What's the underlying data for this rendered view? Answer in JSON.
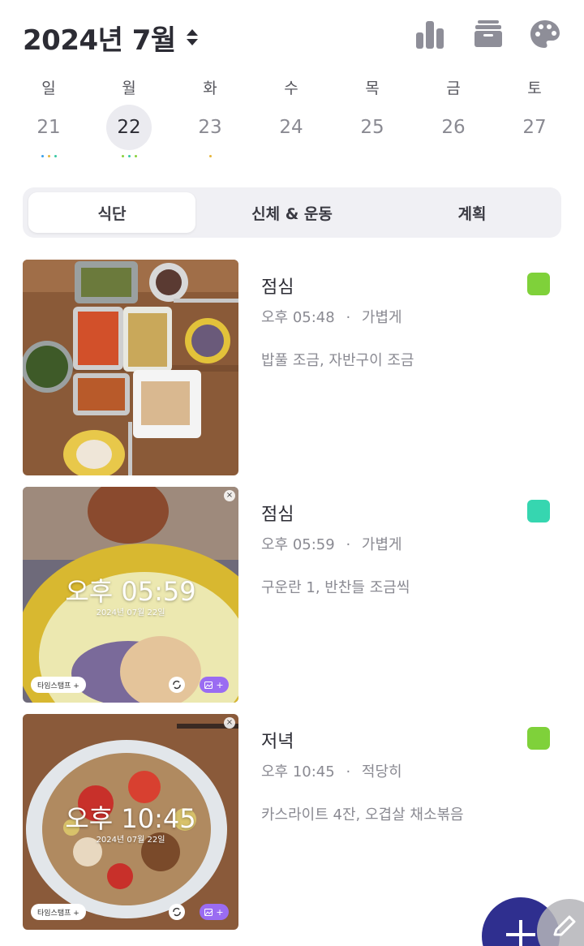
{
  "header": {
    "month_title": "2024년 7월"
  },
  "week": [
    {
      "dow": "일",
      "num": "21",
      "dots": [
        "#3aa0e8",
        "#e6b53a",
        "#38c9a4"
      ]
    },
    {
      "dow": "월",
      "num": "22",
      "selected": true,
      "dots": [
        "#8ad13c",
        "#38c9a4",
        "#8ad13c"
      ]
    },
    {
      "dow": "화",
      "num": "23",
      "dots": [
        "#e6b53a"
      ]
    },
    {
      "dow": "수",
      "num": "24",
      "dots": []
    },
    {
      "dow": "목",
      "num": "25",
      "dots": []
    },
    {
      "dow": "금",
      "num": "26",
      "dots": []
    },
    {
      "dow": "토",
      "num": "27",
      "dots": []
    }
  ],
  "tabs": [
    {
      "label": "식단",
      "active": true
    },
    {
      "label": "신체 & 운동",
      "active": false
    },
    {
      "label": "계획",
      "active": false
    }
  ],
  "entries": [
    {
      "title": "점심",
      "time": "오후 05:48",
      "sep": "·",
      "amount": "가볍게",
      "desc": "밥풀 조금, 자반구이 조금",
      "color": "#7fd13a"
    },
    {
      "title": "점심",
      "time": "오후 05:59",
      "sep": "·",
      "amount": "가볍게",
      "desc": "구운란 1, 반찬들 조금씩",
      "color": "#36d6b0",
      "photo": {
        "time": "오후 05:59",
        "date": "2024년 07월 22일",
        "stamp": "타임스탬프 +",
        "img_btn": "+"
      }
    },
    {
      "title": "저녁",
      "time": "오후 10:45",
      "sep": "·",
      "amount": "적당히",
      "desc": "카스라이트 4잔, 오겹살 채소볶음",
      "color": "#7fd13a",
      "photo": {
        "time": "오후 10:45",
        "date": "2024년 07월 22일",
        "stamp": "타임스탬프 +",
        "img_btn": "+"
      }
    }
  ],
  "icons": [
    "bar-chart-icon",
    "archive-icon",
    "palette-icon",
    "plus-icon",
    "pencil-icon",
    "close-icon",
    "sync-icon",
    "image-icon"
  ]
}
